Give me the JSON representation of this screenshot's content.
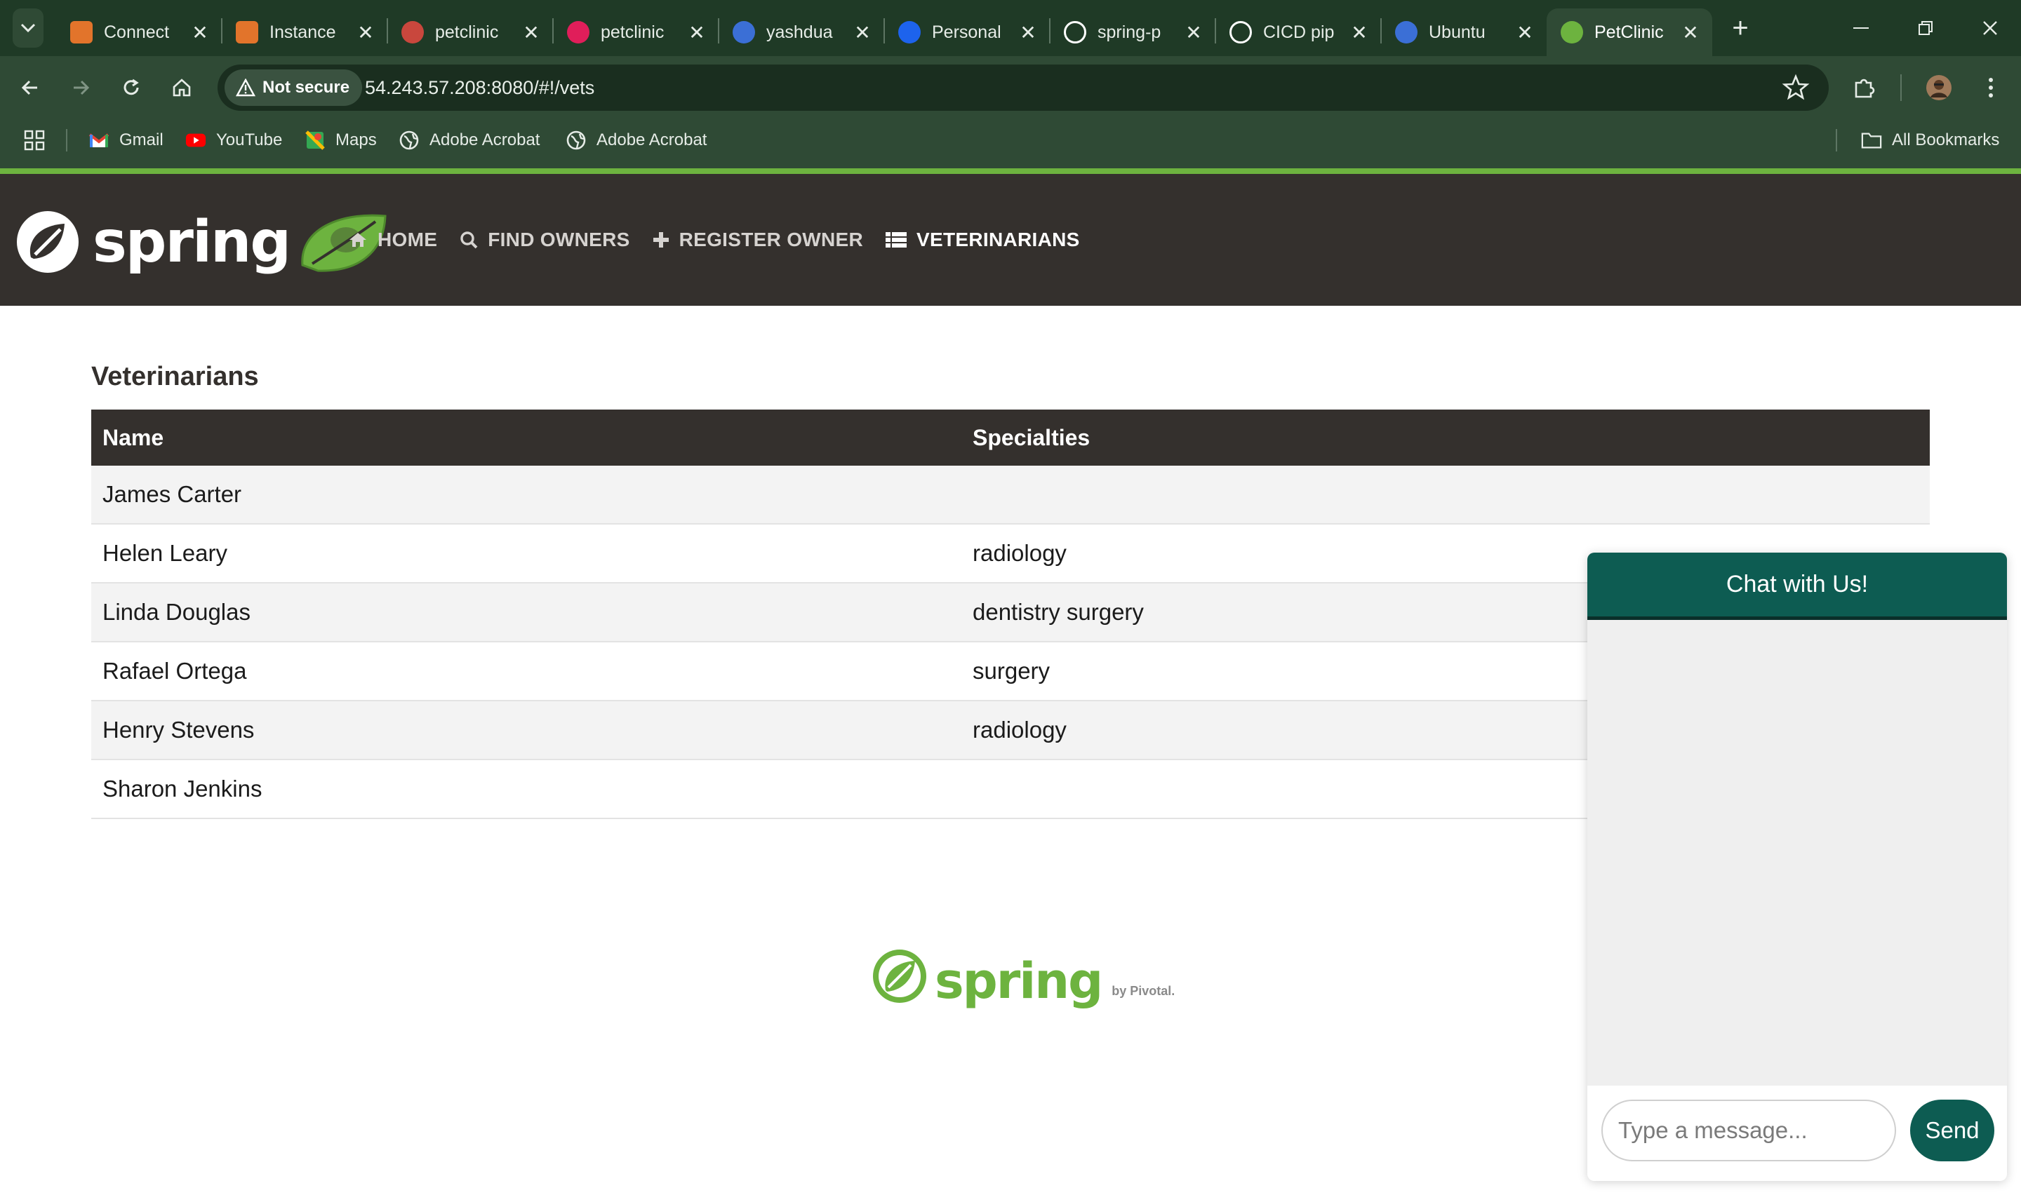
{
  "browser": {
    "tabs": [
      {
        "title": "Connect",
        "icon": "aws-icon",
        "color": "#e2742b"
      },
      {
        "title": "Instance",
        "icon": "aws-icon",
        "color": "#e2742b"
      },
      {
        "title": "petclinic",
        "icon": "jenkins-icon",
        "color": "#c9473d"
      },
      {
        "title": "petclinic",
        "icon": "slack-icon",
        "color": "#e01e5a"
      },
      {
        "title": "yashdua",
        "icon": "digitalocean-icon",
        "color": "#3b6fd6"
      },
      {
        "title": "Personal",
        "icon": "docker-icon",
        "color": "#1d63ed"
      },
      {
        "title": "spring-p",
        "icon": "github-icon",
        "color": "#ffffff"
      },
      {
        "title": "CICD pip",
        "icon": "openai-icon",
        "color": "#ffffff"
      },
      {
        "title": "Ubuntu",
        "icon": "digitalocean-icon",
        "color": "#3b6fd6"
      },
      {
        "title": "PetClinic",
        "icon": "spring-leaf-icon",
        "color": "#6db33f"
      }
    ],
    "security_label": "Not secure",
    "url": "54.243.57.208:8080/#!/vets",
    "bookmarks": [
      {
        "label": "Gmail",
        "icon": "gmail-icon"
      },
      {
        "label": "YouTube",
        "icon": "youtube-icon"
      },
      {
        "label": "Maps",
        "icon": "maps-icon"
      },
      {
        "label": "Adobe Acrobat",
        "icon": "globe-icon"
      },
      {
        "label": "Adobe Acrobat",
        "icon": "globe-icon"
      }
    ],
    "all_bookmarks_label": "All Bookmarks"
  },
  "app": {
    "brand": "spring",
    "nav": [
      {
        "label": "HOME",
        "icon": "home-icon"
      },
      {
        "label": "FIND OWNERS",
        "icon": "search-icon"
      },
      {
        "label": "REGISTER OWNER",
        "icon": "plus-icon"
      },
      {
        "label": "VETERINARIANS",
        "icon": "list-icon"
      }
    ],
    "accent_color": "#6db33f",
    "header_color": "#34302d"
  },
  "page": {
    "title": "Veterinarians",
    "columns": [
      "Name",
      "Specialties"
    ],
    "rows": [
      {
        "name": "James Carter",
        "specialties": ""
      },
      {
        "name": "Helen Leary",
        "specialties": "radiology"
      },
      {
        "name": "Linda Douglas",
        "specialties": "dentistry surgery"
      },
      {
        "name": "Rafael Ortega",
        "specialties": "surgery"
      },
      {
        "name": "Henry Stevens",
        "specialties": "radiology"
      },
      {
        "name": "Sharon Jenkins",
        "specialties": ""
      }
    ]
  },
  "footer": {
    "brand": "spring",
    "by_label": "by Pivotal."
  },
  "chat": {
    "title": "Chat with Us!",
    "placeholder": "Type a message...",
    "send_label": "Send",
    "header_color": "#0d5c52"
  }
}
